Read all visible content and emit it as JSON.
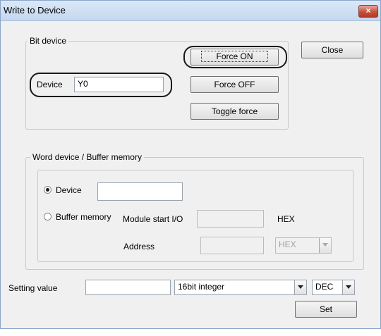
{
  "window": {
    "title": "Write to Device",
    "close_glyph": "×"
  },
  "bit_device": {
    "label": "Bit device",
    "device_label": "Device",
    "device_value": "Y0",
    "force_on_label": "Force ON",
    "force_off_label": "Force OFF",
    "toggle_label": "Toggle force"
  },
  "close_button": {
    "label": "Close"
  },
  "word_device": {
    "label": "Word device / Buffer memory",
    "device_radio_label": "Device",
    "device_value": "",
    "buffer_radio_label": "Buffer memory",
    "module_start_label": "Module start I/O",
    "module_start_value": "",
    "module_hex_label": "HEX",
    "address_label": "Address",
    "address_value": "",
    "address_format": "HEX",
    "selected_radio": "Device"
  },
  "setting": {
    "label": "Setting value",
    "value": "",
    "type_selected": "16bit integer",
    "base_selected": "DEC",
    "set_label": "Set"
  },
  "colors": {
    "title_bg": "#c5d8ef",
    "close_red": "#c7503b",
    "dialog_bg": "#f0f0f0"
  }
}
